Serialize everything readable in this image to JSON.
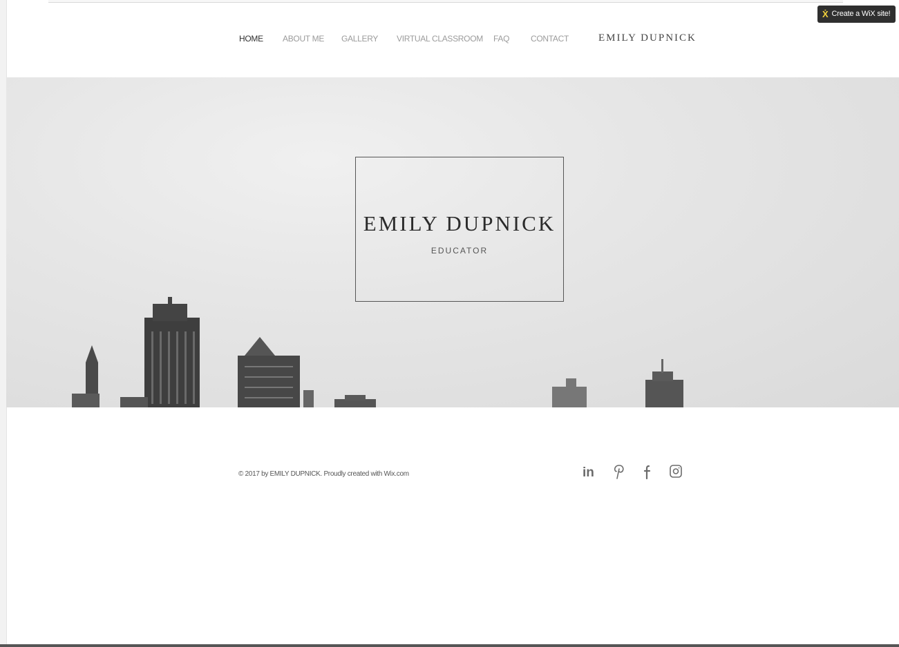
{
  "badge": {
    "label": "Create a WiX site!"
  },
  "nav": {
    "items": [
      {
        "label": "HOME",
        "active": true
      },
      {
        "label": "ABOUT ME"
      },
      {
        "label": "GALLERY"
      },
      {
        "label": "VIRTUAL CLASSROOM"
      },
      {
        "label": "FAQ"
      },
      {
        "label": "CONTACT"
      }
    ]
  },
  "header": {
    "site_name": "EMILY DUPNICK"
  },
  "hero": {
    "title": "EMILY DUPNICK",
    "subtitle": "EDUCATOR"
  },
  "footer": {
    "copyright": "© 2017 by EMILY DUPNICK. Proudly created with Wix.com",
    "social": [
      {
        "icon": "linkedin-icon"
      },
      {
        "icon": "pinterest-icon"
      },
      {
        "icon": "facebook-icon"
      },
      {
        "icon": "instagram-icon"
      }
    ]
  },
  "colors": {
    "nav_active": "#2f2f2f",
    "nav_inactive": "#9b9b9b",
    "badge_bg": "#2f2f2f",
    "badge_accent": "#f2d13c"
  }
}
